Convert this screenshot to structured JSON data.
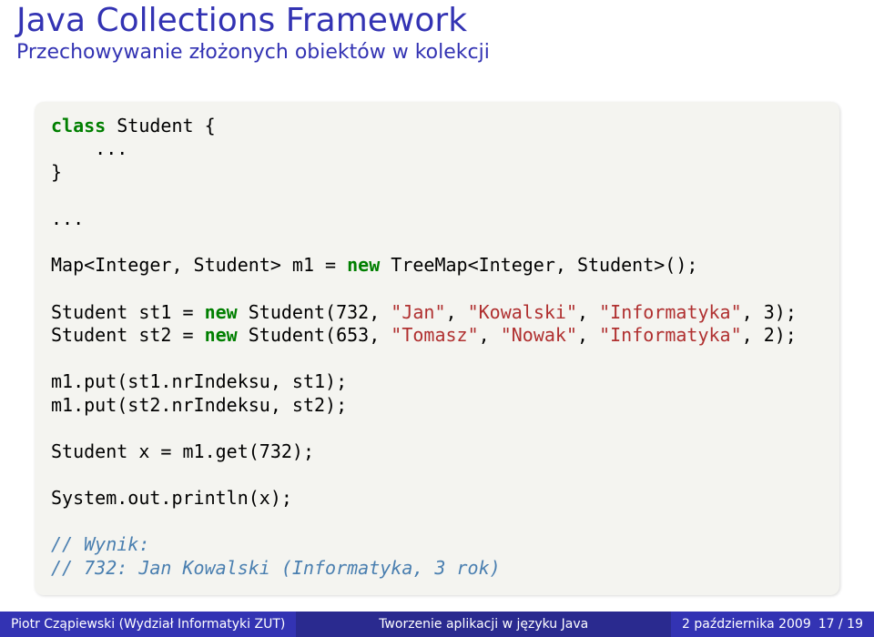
{
  "header": {
    "title": "Java Collections Framework",
    "subtitle": "Przechowywanie złożonych obiektów w kolekcji"
  },
  "code": {
    "kw_class": "class",
    "clsdecl": " Student {",
    "ell1": "    ...",
    "close1": "}",
    "ell2": "...",
    "l3a": "Map<Integer, Student> m1 = ",
    "kw_new1": "new",
    "l3b": " TreeMap<Integer, Student>();",
    "l4a": "Student st1 = ",
    "kw_new2": "new",
    "l4b": " Student(732, ",
    "s_jan": "\"Jan\"",
    "l4c": ", ",
    "s_kow": "\"Kowalski\"",
    "l4d": ", ",
    "s_inf1": "\"Informatyka\"",
    "l4e": ", 3);",
    "l5a": "Student st2 = ",
    "kw_new3": "new",
    "l5b": " Student(653, ",
    "s_tom": "\"Tomasz\"",
    "l5c": ", ",
    "s_now": "\"Nowak\"",
    "l5d": ", ",
    "s_inf2": "\"Informatyka\"",
    "l5e": ", 2);",
    "l6": "m1.put(st1.nrIndeksu, st1);",
    "l7": "m1.put(st2.nrIndeksu, st2);",
    "l8": "Student x = m1.get(732);",
    "l9": "System.out.println(x);",
    "c1": "// Wynik:",
    "c2": "// 732: Jan Kowalski (Informatyka, 3 rok)"
  },
  "footer": {
    "left": "Piotr Cząpiewski (Wydział Informatyki ZUT)",
    "center": "Tworzenie aplikacji w języku Java",
    "right_date": "2 października 2009",
    "right_page": "17 / 19"
  }
}
